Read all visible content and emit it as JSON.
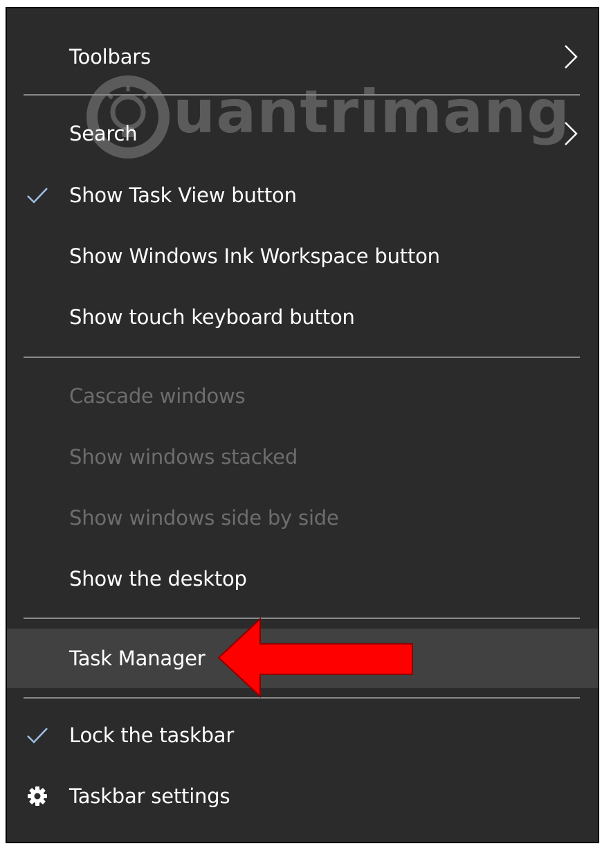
{
  "watermark": {
    "text": "uantrimang"
  },
  "menu": {
    "items": [
      {
        "label": "Toolbars"
      },
      {
        "label": "Search"
      },
      {
        "label": "Show Task View button"
      },
      {
        "label": "Show Windows Ink Workspace button"
      },
      {
        "label": "Show touch keyboard button"
      },
      {
        "label": "Cascade windows"
      },
      {
        "label": "Show windows stacked"
      },
      {
        "label": "Show windows side by side"
      },
      {
        "label": "Show the desktop"
      },
      {
        "label": "Task Manager"
      },
      {
        "label": "Lock the taskbar"
      },
      {
        "label": "Taskbar settings"
      }
    ]
  },
  "icons": {
    "submenu": "chevron-right-icon",
    "checked": "checkmark-icon",
    "settings": "gear-icon",
    "annotation": "red-arrow-icon"
  },
  "colors": {
    "menu_background": "#2b2b2b",
    "hover_background": "#414141",
    "text": "#ffffff",
    "disabled_text": "#6d6d6d",
    "separator": "#8a8a8a",
    "check": "#9ec0e6",
    "arrow": "#ff0000"
  }
}
